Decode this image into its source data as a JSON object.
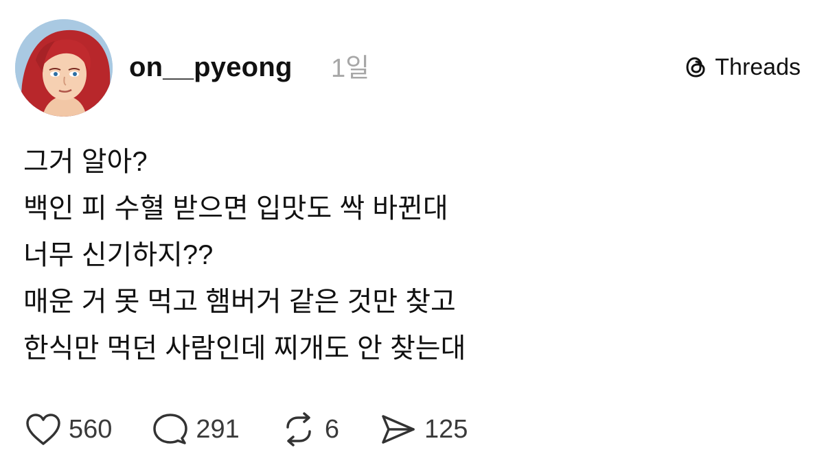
{
  "post": {
    "author": {
      "username": "on__pyeong",
      "avatar": "illustrated-red-haired-character-avatar"
    },
    "time": "1일",
    "brand": {
      "name": "Threads",
      "icon": "threads-logo-icon"
    },
    "lines": [
      "그거 알아?",
      "백인 피 수혈 받으면 입맛도 싹 바뀐대",
      "너무 신기하지??",
      "매운 거 못 먹고 햄버거 같은 것만 찾고",
      "한식만 먹던 사람인데 찌개도 안 찾는대"
    ],
    "actions": {
      "likes": {
        "icon": "heart-icon",
        "count": "560"
      },
      "replies": {
        "icon": "comment-icon",
        "count": "291"
      },
      "reposts": {
        "icon": "repost-icon",
        "count": "6"
      },
      "shares": {
        "icon": "send-icon",
        "count": "125"
      }
    }
  }
}
